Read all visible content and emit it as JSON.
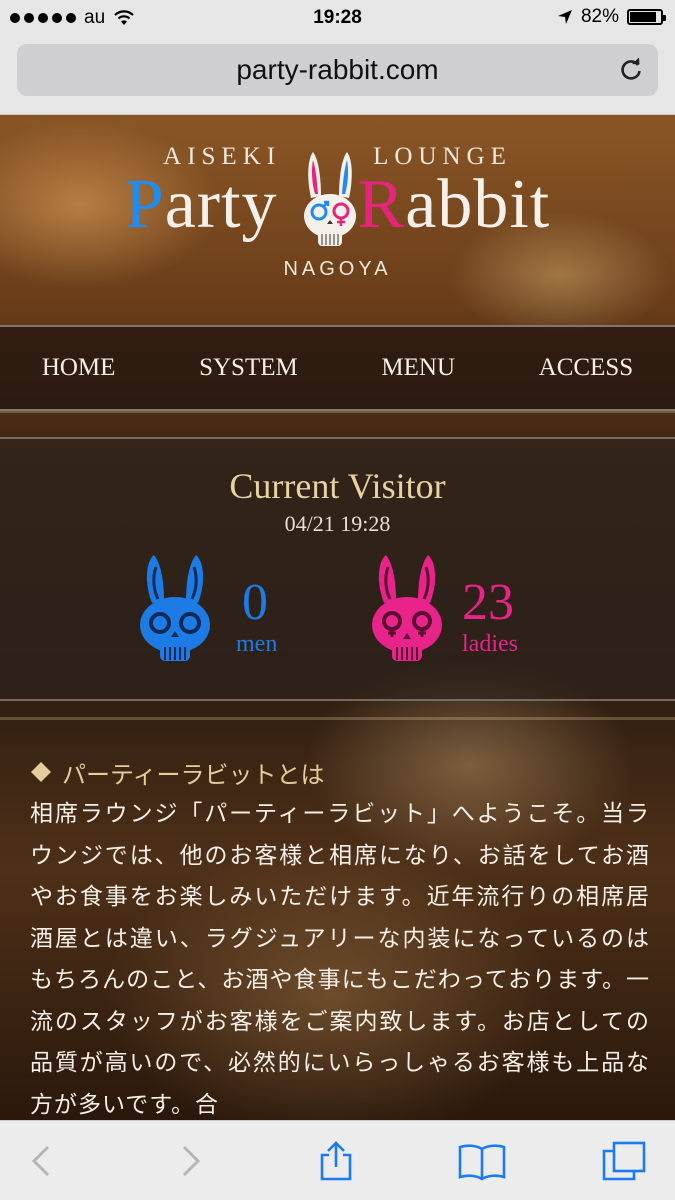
{
  "status_bar": {
    "carrier": "au",
    "time": "19:28",
    "battery_percent": "82%",
    "battery_level": 0.82
  },
  "browser": {
    "url": "party-rabbit.com",
    "reload_icon": "reload-icon",
    "toolbar_icons": [
      "back-icon",
      "forward-icon",
      "share-icon",
      "bookmarks-icon",
      "tabs-icon"
    ]
  },
  "logo": {
    "tagline_left": "AISEKI",
    "tagline_right": "LOUNGE",
    "brand_p": "P",
    "brand_left": "arty",
    "brand_r": "R",
    "brand_right": "abbit",
    "city": "NAGOYA",
    "colors": {
      "blue": "#1f8cf0",
      "pink": "#e8237c"
    }
  },
  "nav": {
    "items": [
      {
        "label": "HOME"
      },
      {
        "label": "SYSTEM"
      },
      {
        "label": "MENU"
      },
      {
        "label": "ACCESS"
      }
    ]
  },
  "visitor": {
    "title": "Current Visitor",
    "datetime": "04/21 19:28",
    "men_count": "0",
    "men_label": "men",
    "ladies_count": "23",
    "ladies_label": "ladies",
    "men_color": "#1d7be6",
    "ladies_color": "#e8238a"
  },
  "about": {
    "heading": "パーティーラビットとは",
    "body": "相席ラウンジ「パーティーラビット」へようこそ。当ラウンジでは、他のお客様と相席になり、お話をしてお酒やお食事をお楽しみいただけます。近年流行りの相席居酒屋とは違い、ラグジュアリーな内装になっているのはもちろんのこと、お酒や食事にもこだわっております。一流のスタッフがお客様をご案内致します。お店としての品質が高いので、必然的にいらっしゃるお客様も上品な方が多いです。合"
  }
}
